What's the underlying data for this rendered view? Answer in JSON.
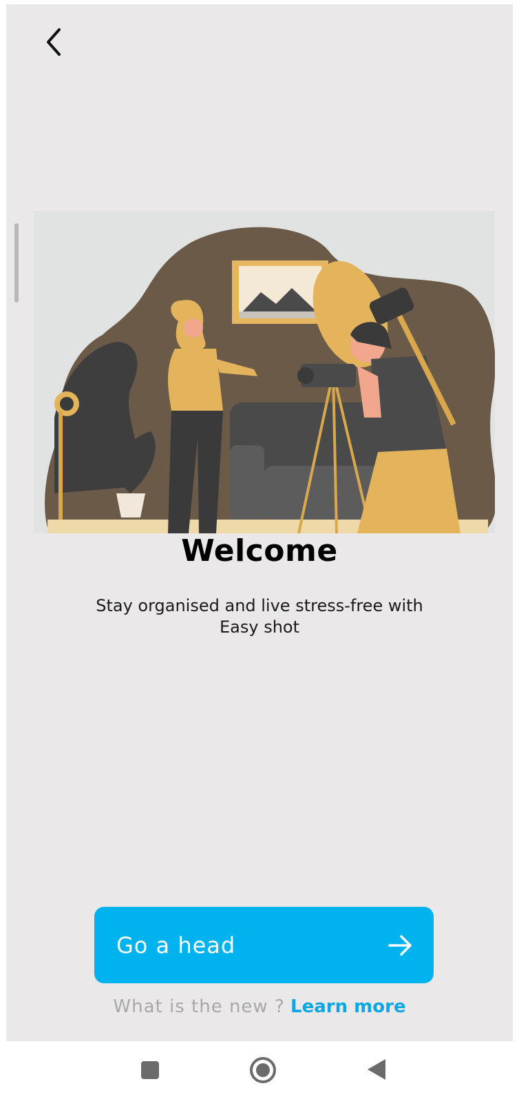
{
  "screen": {
    "title": "Welcome",
    "subtitle": "Stay organised and live stress-free with Easy shot",
    "cta_label": "Go a head",
    "learn_prefix": "What is the new ?",
    "learn_link": "Learn more"
  },
  "colors": {
    "background": "#eae8e9",
    "accent": "#00b2ee",
    "link": "#0aa7e3"
  },
  "icons": {
    "back": "chevron-left-icon",
    "cta": "arrow-right-icon",
    "nav_recents": "square-icon",
    "nav_home": "circle-icon",
    "nav_back": "triangle-back-icon"
  }
}
